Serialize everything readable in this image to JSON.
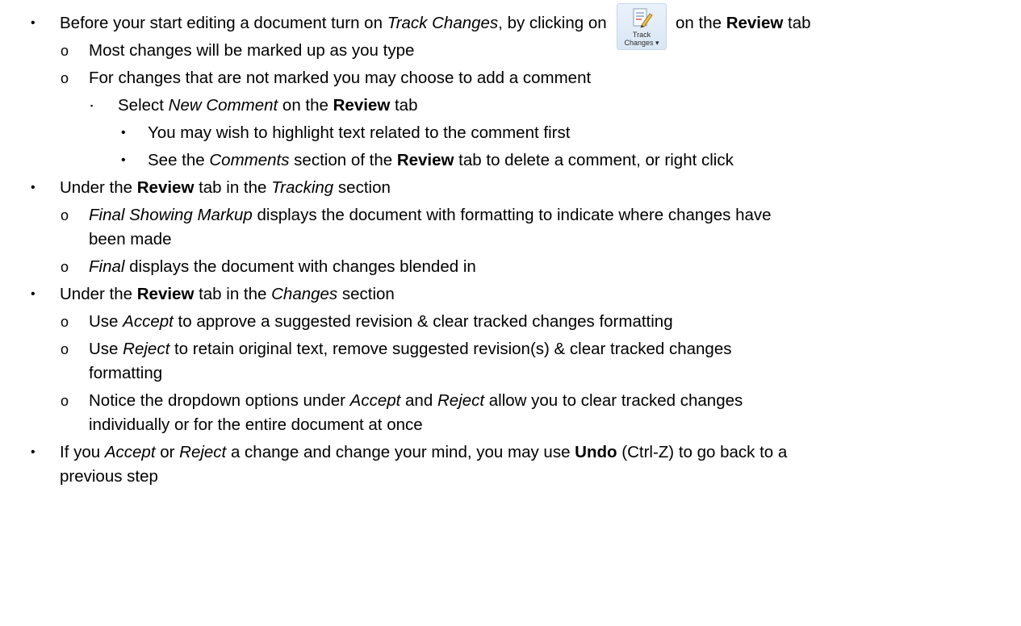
{
  "items": [
    {
      "parts": [
        "Before your start editing a document turn on ",
        "Track Changes",
        ", by clicking on"
      ],
      "after_icon": "on the ",
      "after_icon_bold": "Review",
      "after_icon_end": " tab"
    },
    {
      "text": "Most changes will be marked up as you type"
    },
    {
      "text": "For changes that are not marked you may choose to add a comment"
    },
    {
      "parts": [
        "Select ",
        "New Comment",
        " on the ",
        "Review",
        " tab"
      ]
    },
    {
      "text": "You may wish to highlight text related to the comment first"
    },
    {
      "parts": [
        "See the ",
        "Comments",
        " section of the ",
        "Review",
        " tab to delete a comment, or right click"
      ]
    },
    {
      "parts": [
        "Under the ",
        "Review",
        " tab in the ",
        "Tracking",
        " section"
      ]
    },
    {
      "parts": [
        "Final Showing Markup",
        " displays the document with formatting to indicate where changes have"
      ]
    },
    {
      "text": "been made"
    },
    {
      "parts": [
        "Final",
        " displays the document with changes blended in"
      ]
    },
    {
      "parts": [
        "Under the ",
        "Review",
        " tab in the ",
        "Changes",
        " section"
      ]
    },
    {
      "parts": [
        "Use ",
        "Accept",
        " to approve a suggested revision & clear tracked changes formatting"
      ]
    },
    {
      "parts": [
        "Use ",
        "Reject",
        "  to retain original text, remove suggested revision(s) & clear tracked changes"
      ]
    },
    {
      "text": "formatting"
    },
    {
      "text": "Notice the dropdown options under ",
      "parts": [
        "Notice the dropdown options under ",
        "Accept",
        " and ",
        "Reject",
        " allow you to clear tracked changes"
      ]
    },
    {
      "text": "individually or for the entire document at once"
    },
    {
      "parts": [
        "If you ",
        "Accept",
        " or ",
        "Reject",
        " a change and change your mind, you may use ",
        "Undo",
        " (Ctrl-Z) to go back to a"
      ]
    },
    {
      "text": "previous step"
    }
  ],
  "icon": {
    "name": "track-changes-icon",
    "label_line1": "Track",
    "label_line2": "Changes"
  },
  "bullets": {
    "level1": "•",
    "level2": "o",
    "level3": "▪"
  }
}
